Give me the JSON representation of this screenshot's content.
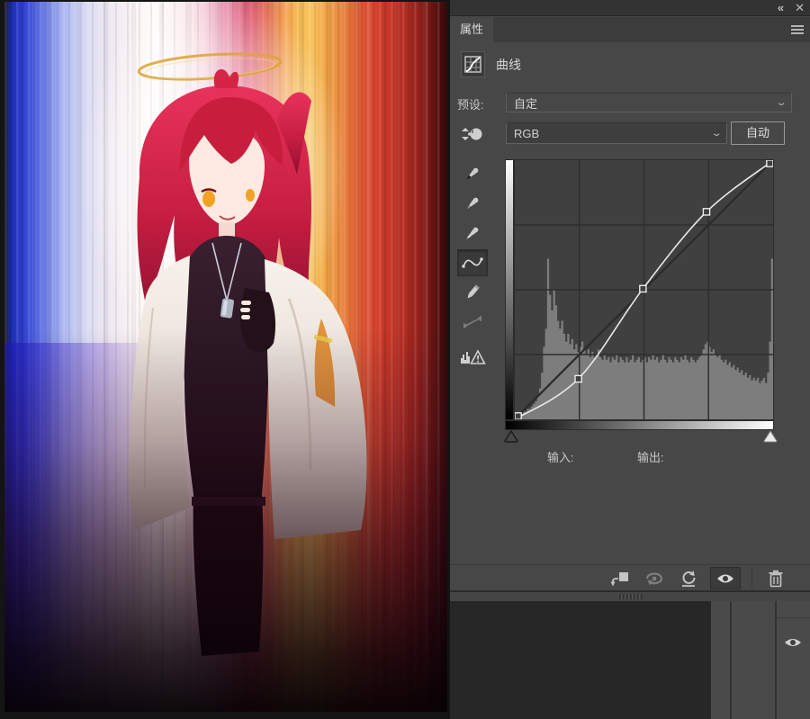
{
  "window": {
    "collapse_glyph": "«",
    "close_glyph": "✕"
  },
  "properties_panel": {
    "tab_label": "属性",
    "adjustment_title": "曲线",
    "preset_label": "预设:",
    "preset_value": "自定",
    "channel_value": "RGB",
    "auto_button_label": "自动",
    "input_label": "输入:",
    "output_label": "输出:"
  },
  "icons": {
    "titlebar": [
      "collapse-panels-icon",
      "close-icon"
    ],
    "panel_menu": "hamburger-menu-icon",
    "adjustment": "curves-adjustment-icon",
    "channel_row": "targeted-adjustment-hand-icon",
    "tool_column": [
      "black-point-eyedropper-icon",
      "gray-point-eyedropper-icon",
      "white-point-eyedropper-icon",
      "edit-curve-points-icon",
      "pencil-draw-curve-icon",
      "smooth-curve-icon",
      "histogram-warning-icon"
    ],
    "footer": [
      "clip-to-layer-icon",
      "previous-state-eye-icon",
      "reset-icon",
      "visibility-eye-icon",
      "trash-icon"
    ],
    "bottom_panel": "layer-visibility-eye-icon"
  },
  "curve_editor": {
    "type": "line",
    "title": "RGB tone curve with luminosity histogram",
    "axis_range": [
      0,
      255
    ],
    "grid_divisions": 4,
    "points": [
      {
        "input": 0,
        "output": 0
      },
      {
        "input": 63,
        "output": 40
      },
      {
        "input": 127,
        "output": 129
      },
      {
        "input": 190,
        "output": 205
      },
      {
        "input": 255,
        "output": 255
      }
    ],
    "histogram": [
      0.01,
      0.01,
      0.02,
      0.02,
      0.03,
      0.03,
      0.04,
      0.04,
      0.05,
      0.06,
      0.07,
      0.09,
      0.12,
      0.18,
      0.28,
      0.35,
      0.62,
      0.48,
      0.42,
      0.5,
      0.44,
      0.38,
      0.35,
      0.38,
      0.33,
      0.3,
      0.33,
      0.29,
      0.31,
      0.27,
      0.29,
      0.26,
      0.28,
      0.3,
      0.27,
      0.25,
      0.27,
      0.24,
      0.26,
      0.24,
      0.25,
      0.27,
      0.24,
      0.23,
      0.25,
      0.23,
      0.24,
      0.22,
      0.24,
      0.23,
      0.25,
      0.22,
      0.24,
      0.23,
      0.22,
      0.24,
      0.22,
      0.23,
      0.25,
      0.22,
      0.23,
      0.24,
      0.22,
      0.23,
      0.24,
      0.22,
      0.24,
      0.23,
      0.25,
      0.23,
      0.24,
      0.22,
      0.23,
      0.25,
      0.23,
      0.22,
      0.24,
      0.23,
      0.22,
      0.24,
      0.23,
      0.22,
      0.24,
      0.23,
      0.25,
      0.23,
      0.22,
      0.24,
      0.23,
      0.22,
      0.23,
      0.24,
      0.25,
      0.27,
      0.29,
      0.3,
      0.28,
      0.26,
      0.27,
      0.25,
      0.24,
      0.25,
      0.23,
      0.22,
      0.23,
      0.21,
      0.22,
      0.2,
      0.21,
      0.19,
      0.2,
      0.18,
      0.19,
      0.17,
      0.18,
      0.16,
      0.17,
      0.15,
      0.16,
      0.15,
      0.16,
      0.14,
      0.15,
      0.16,
      0.14,
      0.18,
      0.3,
      0.62
    ],
    "colors": {
      "curve": "#e8e8e8",
      "histogram": "#7d7d7d",
      "grid": "#2e2e2e",
      "baseline": "#2b2b2b",
      "plot_bg": "#404040"
    }
  },
  "artwork_colors": {
    "halo": "#dfa43c",
    "hair": "#d42547",
    "eye": "#f2a227",
    "jacket": "#f2ebe3",
    "top": "#2b1520"
  }
}
